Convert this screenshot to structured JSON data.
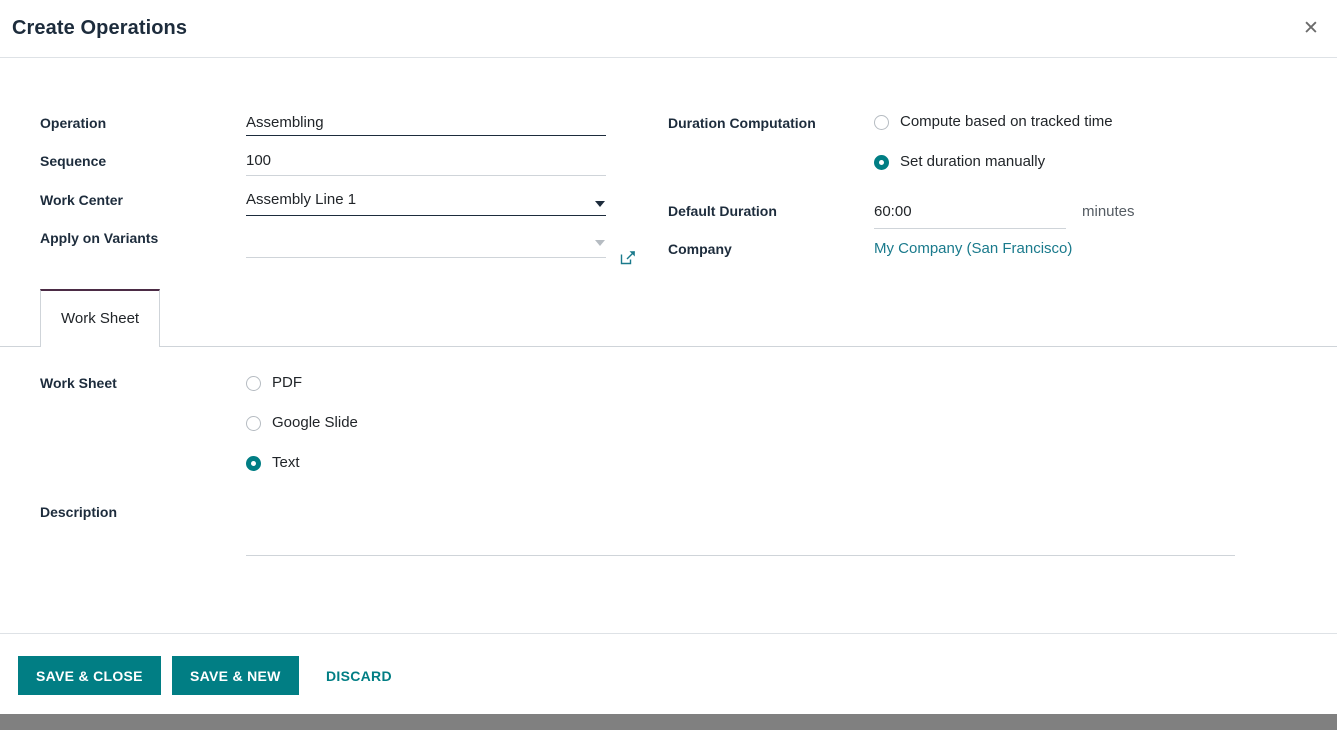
{
  "dialog": {
    "title": "Create Operations",
    "close_icon": "close-icon"
  },
  "form": {
    "left": {
      "operation": {
        "label": "Operation",
        "value": "Assembling"
      },
      "sequence": {
        "label": "Sequence",
        "value": "100"
      },
      "work_center": {
        "label": "Work Center",
        "value": "Assembly Line 1",
        "caret_icon": "chevron-down-icon",
        "external_link_icon": "external-link-icon"
      },
      "apply_on_variants": {
        "label": "Apply on Variants",
        "value": "",
        "caret_icon": "chevron-down-icon"
      }
    },
    "right": {
      "duration_computation": {
        "label": "Duration Computation",
        "options": [
          {
            "label": "Compute based on tracked time",
            "selected": false
          },
          {
            "label": "Set duration manually",
            "selected": true
          }
        ]
      },
      "default_duration": {
        "label": "Default Duration",
        "value": "60:00",
        "unit": "minutes"
      },
      "company": {
        "label": "Company",
        "value": "My Company (San Francisco)"
      }
    }
  },
  "notebook": {
    "tabs": [
      {
        "label": "Work Sheet",
        "active": true
      }
    ]
  },
  "worksheet": {
    "label": "Work Sheet",
    "options": [
      {
        "label": "PDF",
        "selected": false
      },
      {
        "label": "Google Slide",
        "selected": false
      },
      {
        "label": "Text",
        "selected": true
      }
    ],
    "description": {
      "label": "Description",
      "value": ""
    }
  },
  "footer": {
    "save_close": "SAVE & CLOSE",
    "save_new": "SAVE & NEW",
    "discard": "DISCARD"
  },
  "colors": {
    "accent": "#017e84",
    "link": "#1a7a8c",
    "tab_active_border": "#4b2b45",
    "bottom_bar": "#808080"
  }
}
